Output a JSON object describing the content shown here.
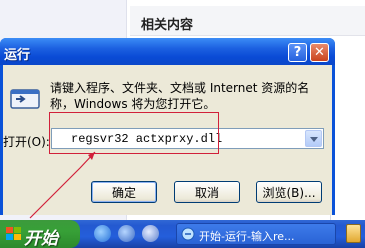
{
  "background": {
    "heading": "相关内容"
  },
  "dialog": {
    "title": "运行",
    "help_label": "?",
    "close_label": "✕",
    "prompt": "请键入程序、文件夹、文档或 Internet 资源的名称，Windows 将为您打开它。",
    "open_label": "打开(O):",
    "input_value": "regsvr32 actxprxy.dll",
    "ok_label": "确定",
    "cancel_label": "取消",
    "browse_label": "浏览(B)..."
  },
  "taskbar": {
    "start_label": "开始",
    "task_label": "开始-运行-输入re..."
  },
  "icons": [
    "run-icon",
    "help-icon",
    "close-icon",
    "dropdown-arrow-icon",
    "windows-logo-icon",
    "ie-icon",
    "media-player-icon",
    "show-desktop-icon",
    "task-window-icon",
    "tray-icon"
  ]
}
